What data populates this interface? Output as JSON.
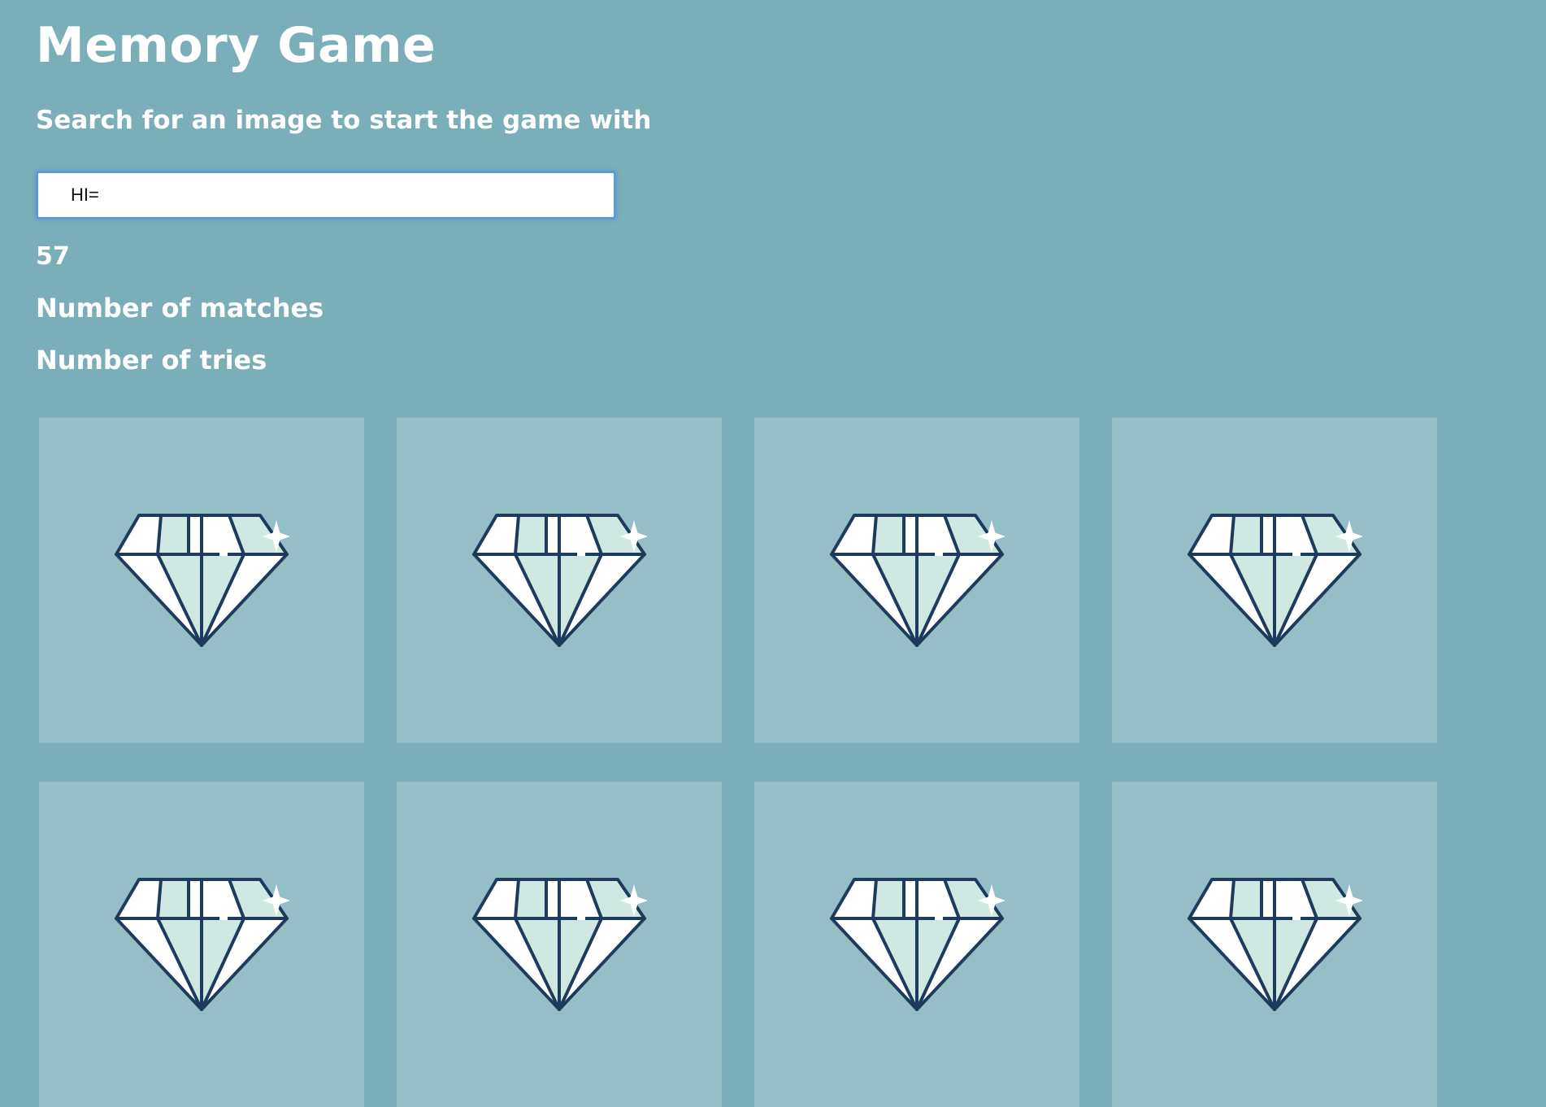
{
  "app": {
    "title": "Memory Game",
    "subtitle": "Search for an image to start the game with"
  },
  "search": {
    "value": "HI="
  },
  "timer": {
    "value": "57"
  },
  "stats": {
    "matches_label": "Number of matches",
    "tries_label": "Number of tries"
  },
  "cards": [
    {
      "face": "diamond-icon",
      "state": "face-down"
    },
    {
      "face": "diamond-icon",
      "state": "face-down"
    },
    {
      "face": "diamond-icon",
      "state": "face-down"
    },
    {
      "face": "diamond-icon",
      "state": "face-down"
    },
    {
      "face": "diamond-icon",
      "state": "face-down"
    },
    {
      "face": "diamond-icon",
      "state": "face-down"
    },
    {
      "face": "diamond-icon",
      "state": "face-down"
    },
    {
      "face": "diamond-icon",
      "state": "face-down"
    }
  ],
  "colors": {
    "background": "#7aaeb8",
    "card_background": "#95bec6",
    "diamond_outline": "#1d3b5c",
    "diamond_facet": "#cfe8e2",
    "text": "#ffffff"
  }
}
